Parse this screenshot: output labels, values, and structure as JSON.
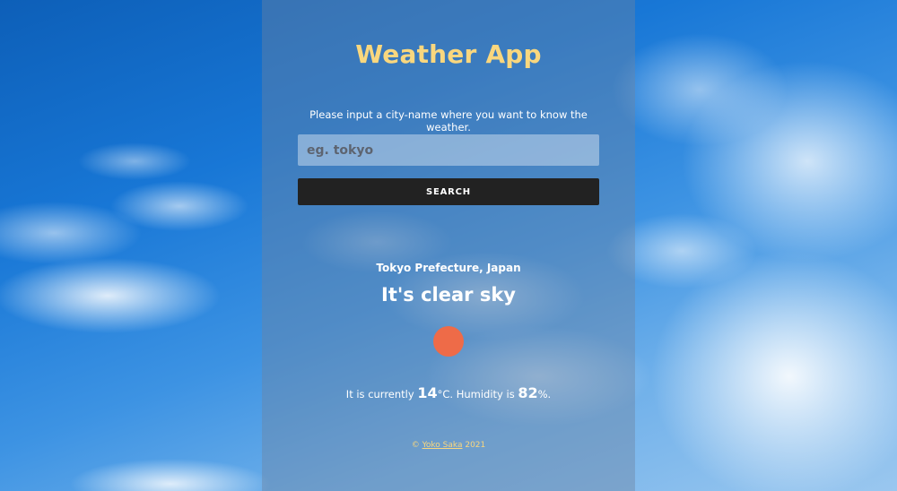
{
  "app": {
    "title": "Weather App",
    "prompt": "Please input a city-name where you want to know the weather."
  },
  "search": {
    "placeholder": "eg. tokyo",
    "value": "",
    "button_label": "SEARCH"
  },
  "weather": {
    "location": "Tokyo Prefecture, Japan",
    "condition": "It's clear sky",
    "icon": "sun-icon",
    "stats_prefix": "It is currently ",
    "temperature": "14",
    "temperature_unit": "°C. Humidity is ",
    "humidity": "82",
    "humidity_unit": "%."
  },
  "footer": {
    "copyright": "© ",
    "author": "Yoko Saka",
    "year": " 2021"
  },
  "colors": {
    "accent": "#f9d77e",
    "button": "#222222",
    "sun": "#ee6b48"
  }
}
